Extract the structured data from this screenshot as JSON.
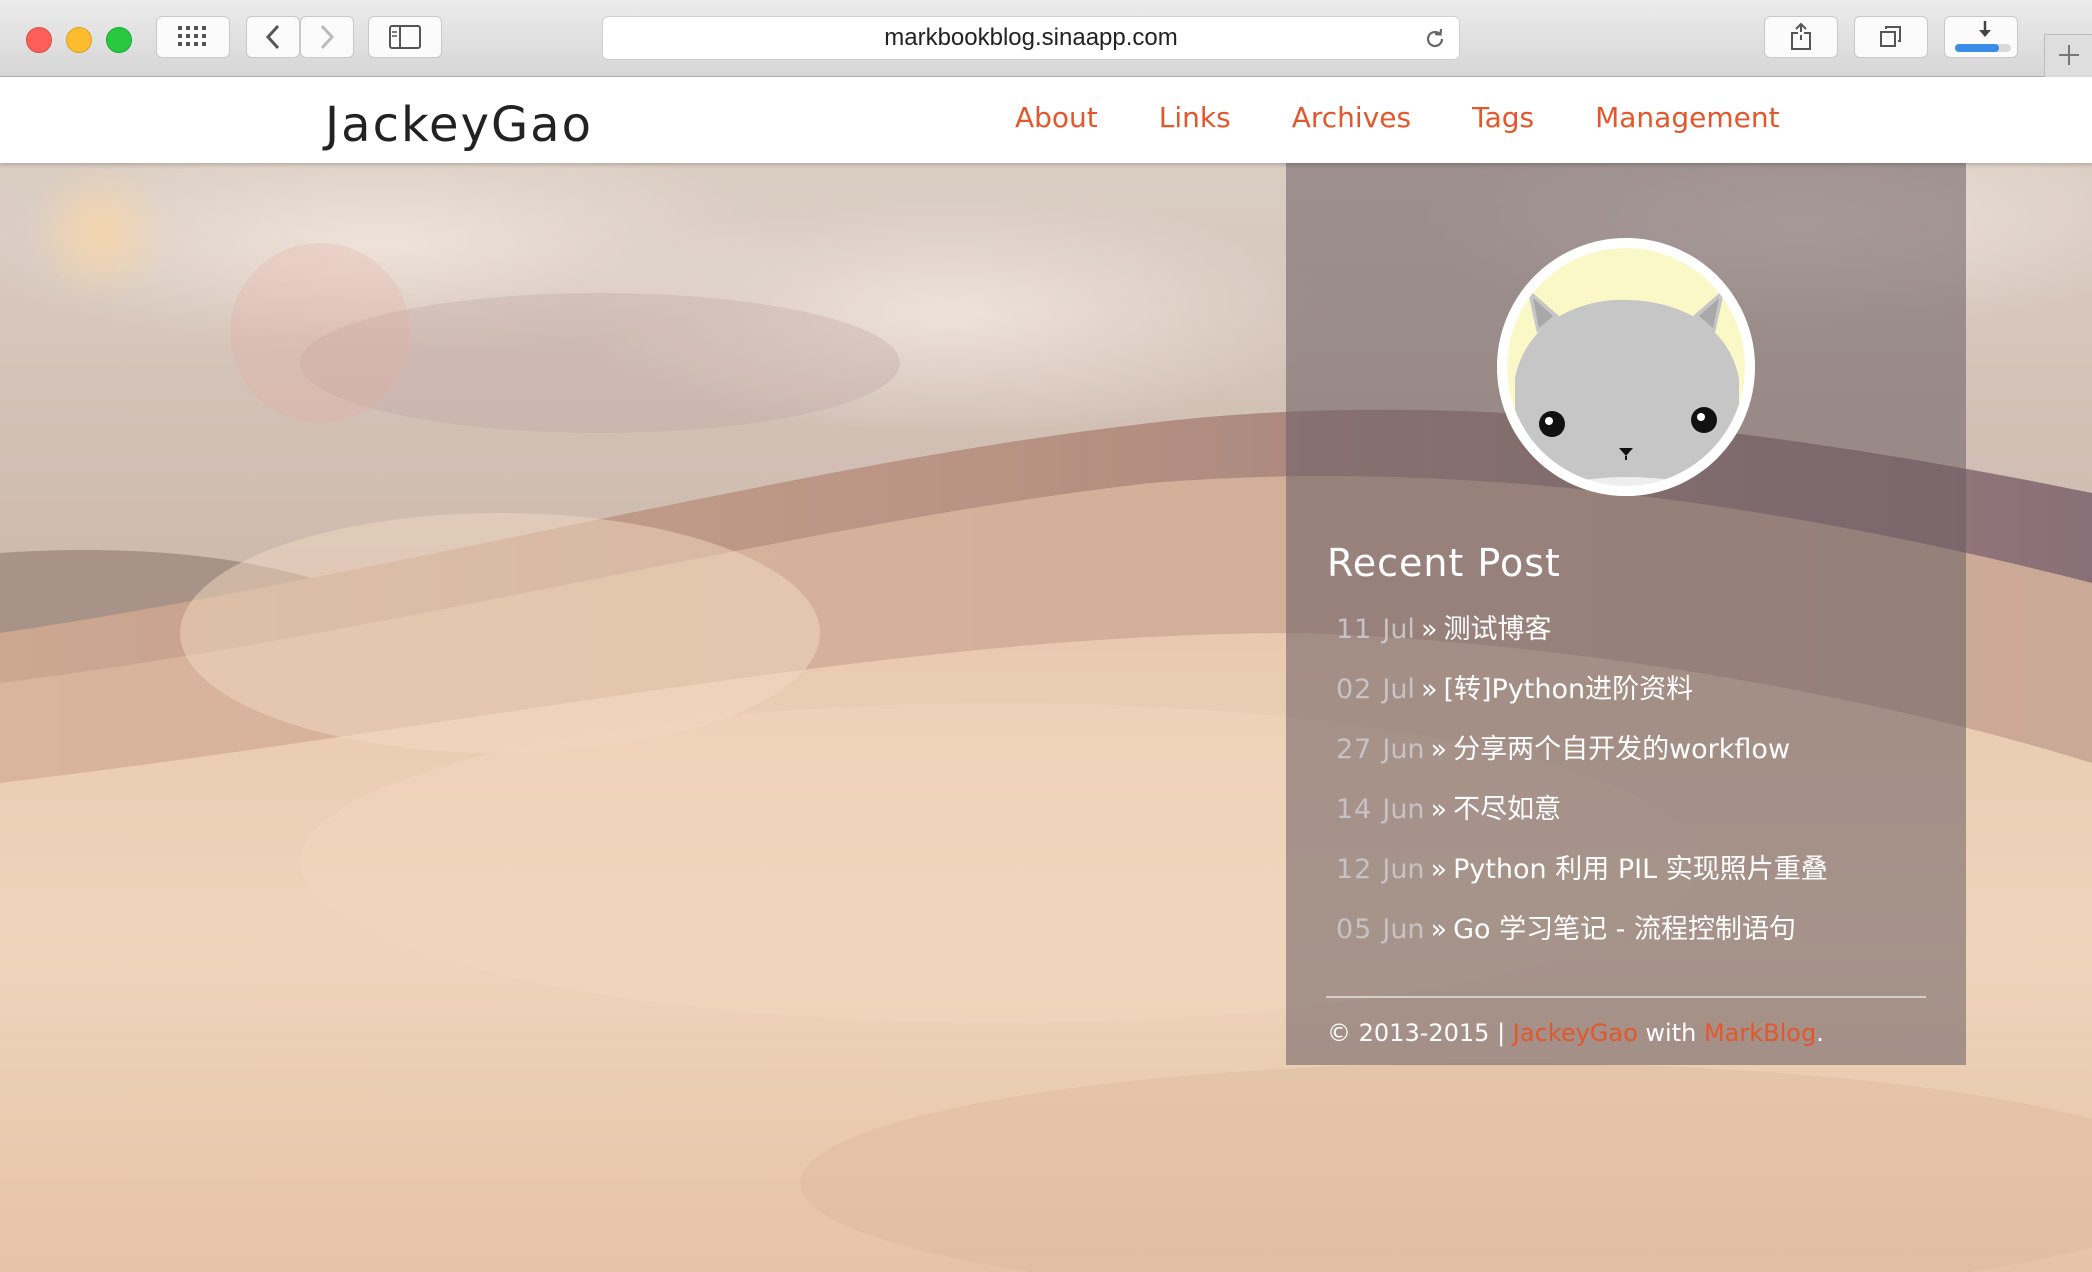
{
  "browser": {
    "url": "markbookblog.sinaapp.com"
  },
  "site": {
    "brand": "JackeyGao",
    "nav": [
      "About",
      "Links",
      "Archives",
      "Tags",
      "Management"
    ],
    "accent_color": "#e2572b"
  },
  "sidebar": {
    "title": "Recent Post",
    "separator": "»",
    "posts": [
      {
        "day": "11",
        "month": "Jul",
        "title": "测试博客"
      },
      {
        "day": "02",
        "month": "Jul",
        "title": "[转]Python进阶资料"
      },
      {
        "day": "27",
        "month": "Jun",
        "title": "分享两个自开发的workflow"
      },
      {
        "day": "14",
        "month": "Jun",
        "title": "不尽如意"
      },
      {
        "day": "12",
        "month": "Jun",
        "title": "Python 利用 PIL 实现照片重叠"
      },
      {
        "day": "05",
        "month": "Jun",
        "title": "Go 学习笔记 - 流程控制语句"
      }
    ],
    "footer": {
      "prefix": "© 2013-2015 | ",
      "author_link": "JackeyGao",
      "middle": " with ",
      "engine_link": "MarkBlog",
      "suffix": "."
    }
  },
  "icons": {
    "grid": "top-sites-grid-icon",
    "back": "chevron-left-icon",
    "forward": "chevron-right-icon",
    "sidebar": "sidebar-icon",
    "reload": "reload-icon",
    "share": "share-icon",
    "tabs": "tabs-overview-icon",
    "downloads": "download-icon",
    "new_tab": "plus-icon"
  }
}
